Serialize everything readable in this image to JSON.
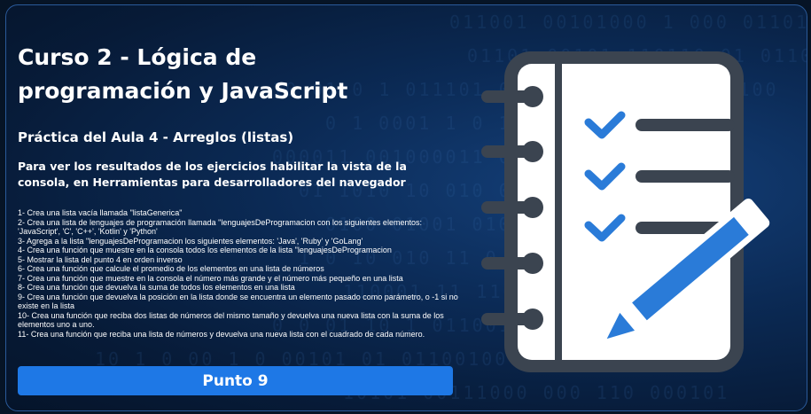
{
  "header": {
    "title": "Curso 2 - Lógica de programación y JavaScript",
    "subtitle": "Práctica del Aula 4 - Arreglos (listas)",
    "description": "Para ver los resultados de los ejercicios habilitar la vista de la consola, en Herramientas para desarrolladores del navegador"
  },
  "exercises": [
    "1- Crea una lista vacía llamada \"listaGenerica\"",
    "2- Crea una lista de lenguajes de programación llamada \"lenguajesDeProgramacion con los siguientes elementos: 'JavaScript', 'C', 'C++', 'Kotlin' y 'Python'",
    "3- Agrega a la lista \"lenguajesDeProgramacion los siguientes elementos: 'Java', 'Ruby' y 'GoLang'",
    "4- Crea una función que muestre en la consola todos los elementos de la lista \"lenguajesDeProgramacion",
    "5- Mostrar la lista del punto 4 en orden inverso",
    "6- Crea una función que calcule el promedio de los elementos en una lista de números",
    "7- Crea una función que muestre en la consola el número más grande y el número más pequeño en una lista",
    "8- Crea una función que devuelva la suma de todos los elementos en una lista",
    "9- Crea una función que devuelva la posición en la lista donde se encuentra un elemento pasado como parámetro, o -1 si no existe en la lista",
    "10- Crea una función que reciba dos listas de números del mismo tamaño y devuelva una nueva lista con la suma de los elementos uno a uno.",
    "11- Crea una función que reciba una lista de números y devuelva una nueva lista con el cuadrado de cada número."
  ],
  "button": {
    "label": "Punto 9",
    "color": "#1e78e6"
  },
  "illustration": {
    "icon": "checklist-notebook-pencil-icon",
    "colors": {
      "frame": "#3b4450",
      "check": "#2a7bd8",
      "pencil": "#2a7bd8",
      "page": "#ffffff"
    }
  }
}
